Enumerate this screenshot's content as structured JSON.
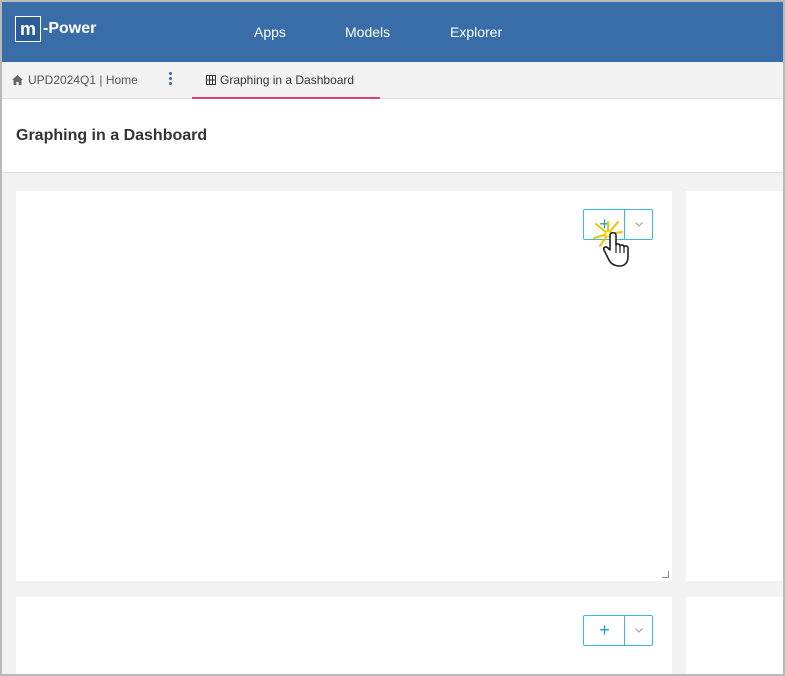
{
  "header": {
    "logo_letter": "m",
    "logo_text": "-Power",
    "nav": [
      "Apps",
      "Models",
      "Explorer"
    ]
  },
  "tabs": {
    "home_label": "UPD2024Q1 | Home",
    "active_label": "Graphing in a Dashboard"
  },
  "page": {
    "title": "Graphing in a Dashboard"
  },
  "panels": {
    "add_symbol": "+"
  },
  "colors": {
    "header_bg": "#386da8",
    "tab_active_underline": "#e23f7a",
    "button_border": "#39bcd3",
    "page_bg": "#f2f2f2"
  },
  "icons": {
    "home": "home-icon",
    "kebab": "kebab-menu-icon",
    "dashboard": "dashboard-grid-icon",
    "add": "plus-icon",
    "dropdown": "chevron-down-icon",
    "cursor": "hand-pointer-cursor-icon"
  }
}
